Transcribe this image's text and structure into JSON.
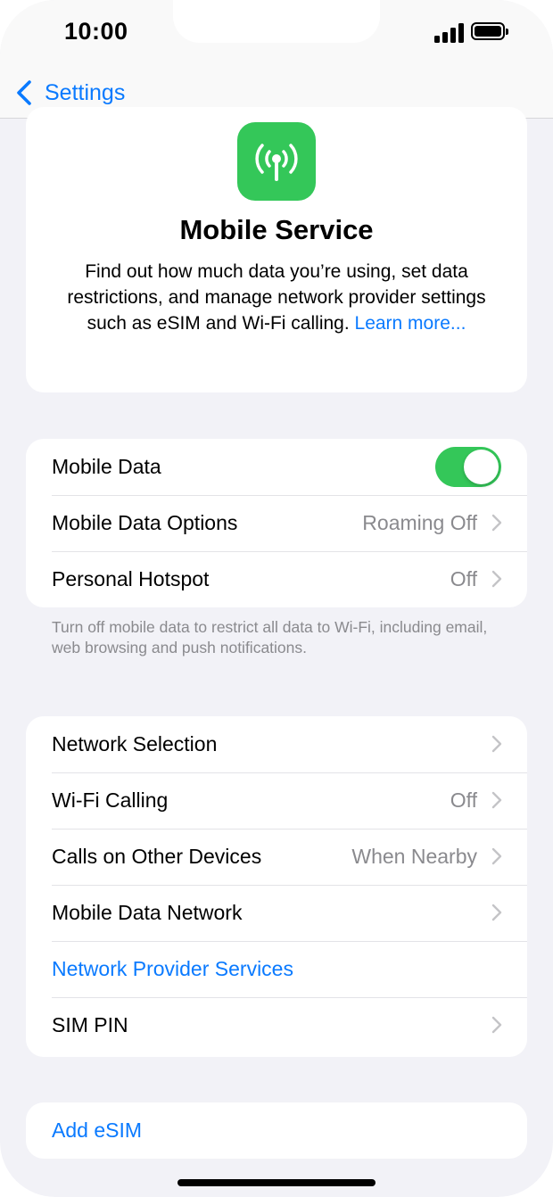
{
  "status_bar": {
    "time": "10:00"
  },
  "nav": {
    "back_label": "Settings"
  },
  "header": {
    "title": "Mobile Service",
    "description": "Find out how much data you’re using, set data restrictions, and manage network provider settings such as eSIM and Wi-Fi calling. ",
    "learn_more": "Learn more..."
  },
  "data_group": {
    "rows": [
      {
        "label": "Mobile Data",
        "toggle_on": true
      },
      {
        "label": "Mobile Data Options",
        "value": "Roaming Off"
      },
      {
        "label": "Personal Hotspot",
        "value": "Off"
      }
    ],
    "footer": "Turn off mobile data to restrict all data to Wi-Fi, including email, web browsing and push notifications."
  },
  "network_group": {
    "rows": [
      {
        "label": "Network Selection",
        "value": ""
      },
      {
        "label": "Wi-Fi Calling",
        "value": "Off"
      },
      {
        "label": "Calls on Other Devices",
        "value": "When Nearby"
      },
      {
        "label": "Mobile Data Network",
        "value": ""
      },
      {
        "label": "Network Provider Services"
      },
      {
        "label": "SIM PIN",
        "value": ""
      }
    ]
  },
  "esim_group": {
    "add_esim_label": "Add eSIM"
  },
  "colors": {
    "accent": "#0a7aff",
    "toggle_on": "#34c759",
    "background": "#f2f2f7",
    "secondary_text": "#8a8a8e"
  }
}
